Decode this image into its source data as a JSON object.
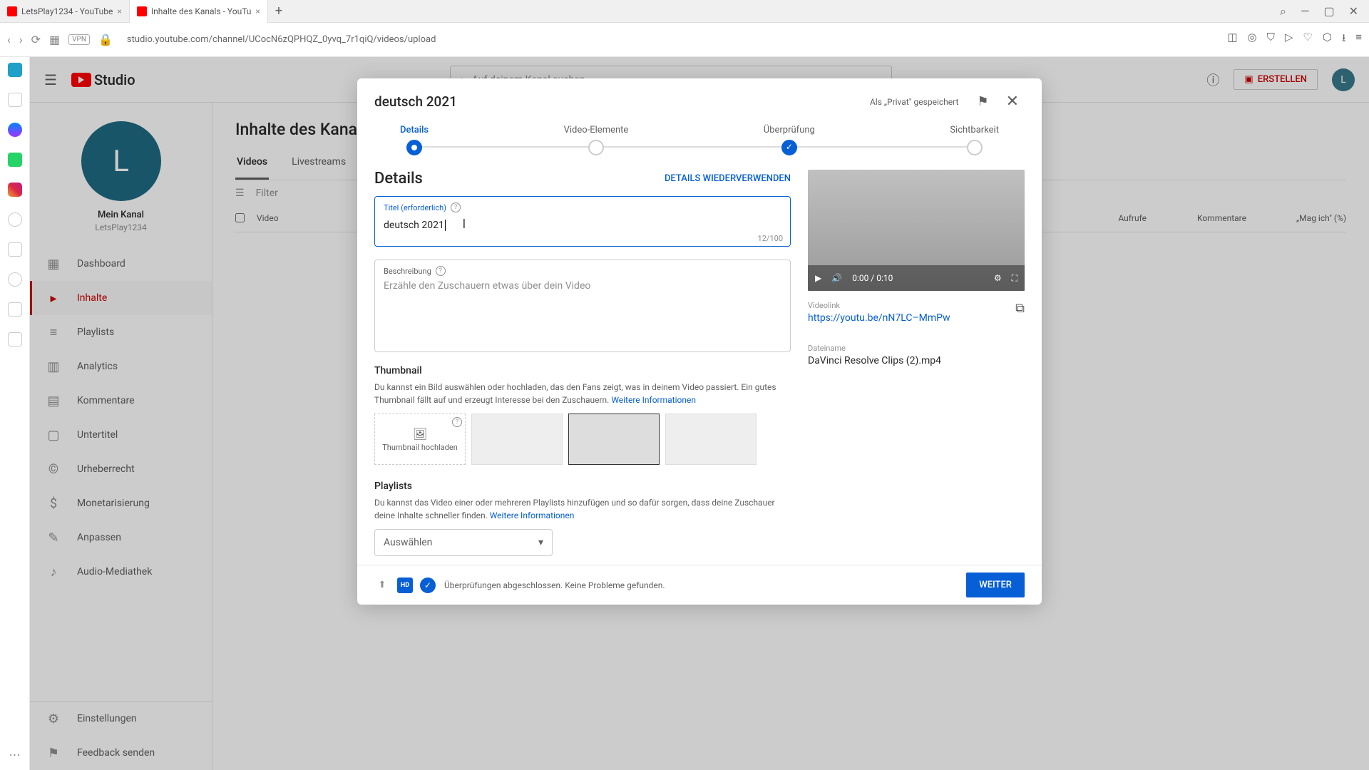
{
  "browser": {
    "tabs": [
      {
        "title": "LetsPlay1234 - YouTube"
      },
      {
        "title": "Inhalte des Kanals - YouTu"
      }
    ],
    "url": "studio.youtube.com/channel/UCocN6zQPHQZ_0yvq_7r1qiQ/videos/upload",
    "vpn": "VPN"
  },
  "studio": {
    "logo": "Studio",
    "search_placeholder": "Auf deinem Kanal suchen",
    "create": "ERSTELLEN",
    "avatar_letter": "L",
    "channel": {
      "letter": "L",
      "name": "Mein Kanal",
      "handle": "LetsPlay1234"
    },
    "nav": {
      "dashboard": "Dashboard",
      "content": "Inhalte",
      "playlists": "Playlists",
      "analytics": "Analytics",
      "comments": "Kommentare",
      "subtitles": "Untertitel",
      "copyright": "Urheberrecht",
      "monetization": "Monetarisierung",
      "customization": "Anpassen",
      "audio": "Audio-Mediathek",
      "settings": "Einstellungen",
      "feedback": "Feedback senden"
    },
    "page": {
      "title": "Inhalte des Kanals",
      "tab_videos": "Videos",
      "tab_live": "Livestreams",
      "filter": "Filter",
      "col_video": "Video",
      "col_views": "Aufrufe",
      "col_comments": "Kommentare",
      "col_likes": "„Mag ich\" (%)"
    }
  },
  "modal": {
    "title": "deutsch 2021",
    "saved": "Als „Privat\" gespeichert",
    "steps": {
      "details": "Details",
      "elements": "Video-Elemente",
      "checks": "Überprüfung",
      "visibility": "Sichtbarkeit"
    },
    "details": {
      "heading": "Details",
      "reuse": "DETAILS WIEDERVERWENDEN",
      "title_label": "Titel (erforderlich)",
      "title_value": "deutsch 2021",
      "title_count": "12/100",
      "desc_label": "Beschreibung",
      "desc_placeholder": "Erzähle den Zuschauern etwas über dein Video",
      "thumb_heading": "Thumbnail",
      "thumb_desc": "Du kannst ein Bild auswählen oder hochladen, das den Fans zeigt, was in deinem Video passiert. Ein gutes Thumbnail fällt auf und erzeugt Interesse bei den Zuschauern. ",
      "thumb_link": "Weitere Informationen",
      "thumb_upload": "Thumbnail hochladen",
      "playlists_heading": "Playlists",
      "playlists_desc": "Du kannst das Video einer oder mehreren Playlists hinzufügen und so dafür sorgen, dass deine Zuschauer deine Inhalte schneller finden. ",
      "playlists_link": "Weitere Informationen",
      "select_placeholder": "Auswählen"
    },
    "preview": {
      "time": "0:00 / 0:10",
      "link_label": "Videolink",
      "link": "https://youtu.be/nN7LC–MmPw",
      "file_label": "Dateiname",
      "file": "DaVinci Resolve Clips (2).mp4"
    },
    "footer": {
      "hd": "HD",
      "msg": "Überprüfungen abgeschlossen. Keine Probleme gefunden.",
      "next": "WEITER"
    }
  }
}
